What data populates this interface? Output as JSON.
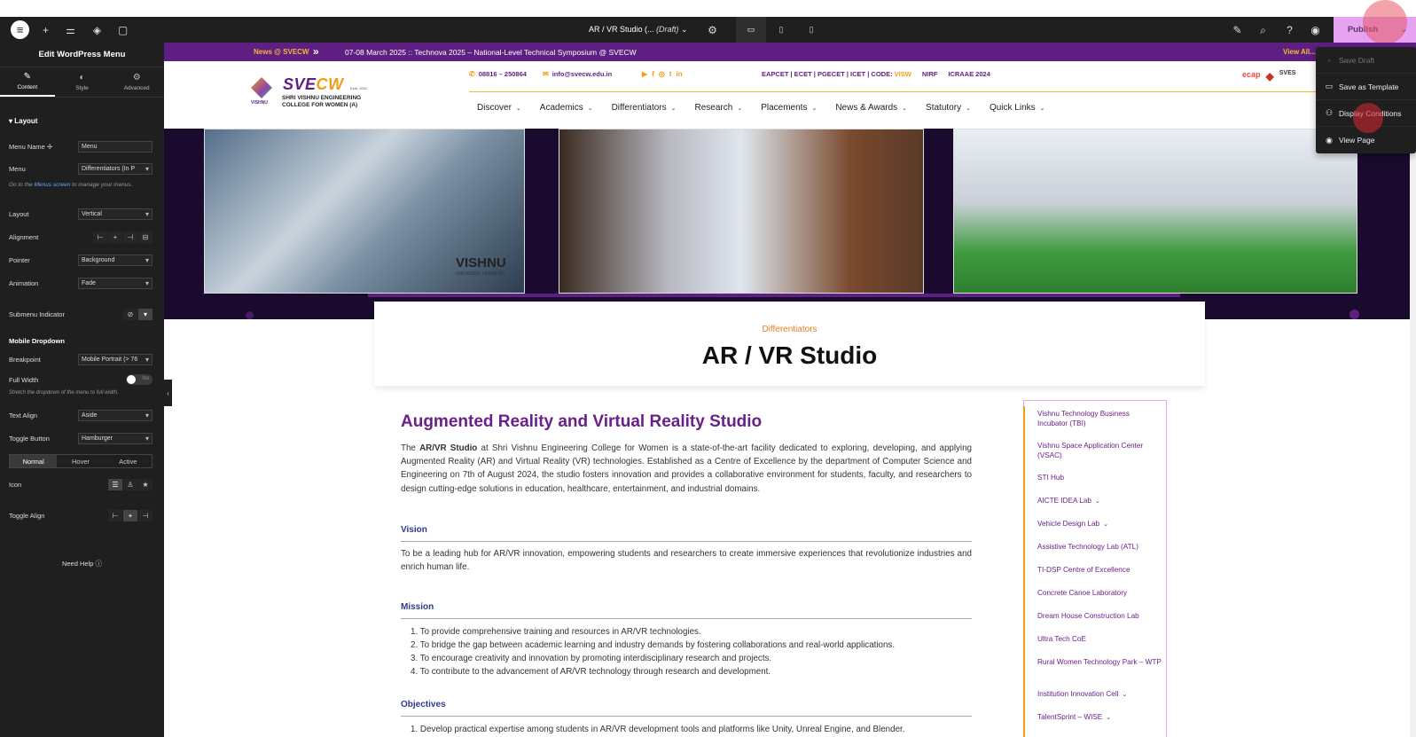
{
  "topbar": {
    "logo_icon": "elementor-logo-icon",
    "doc_title": "AR / VR Studio (... ",
    "doc_status": "(Draft)",
    "publish_label": "Publish"
  },
  "publish_menu": {
    "items": [
      {
        "label": "Save Draft",
        "icon": "save-draft-icon"
      },
      {
        "label": "Save as Template",
        "icon": "folder-icon"
      },
      {
        "label": "Display Conditions",
        "icon": "conditions-icon"
      },
      {
        "label": "View Page",
        "icon": "eye-icon"
      }
    ]
  },
  "panel": {
    "title": "Edit WordPress Menu",
    "tabs": [
      "Content",
      "Style",
      "Advanced"
    ],
    "section": "Layout",
    "menu_name_label": "Menu Name",
    "menu_name_value": "Menu",
    "menu_label": "Menu",
    "menu_value": "Differentiators (In P",
    "menus_hint_pre": "Go to the",
    "menus_hint_link": "Menus screen",
    "menus_hint_post": "to manage your menus.",
    "layout_label": "Layout",
    "layout_value": "Vertical",
    "alignment_label": "Alignment",
    "pointer_label": "Pointer",
    "pointer_value": "Background",
    "animation_label": "Animation",
    "animation_value": "Fade",
    "submenu_indicator_label": "Submenu Indicator",
    "mobile_dropdown_heading": "Mobile Dropdown",
    "breakpoint_label": "Breakpoint",
    "breakpoint_value": "Mobile Portrait (> 76",
    "full_width_label": "Full Width",
    "full_width_toggle": "No",
    "full_width_hint": "Stretch the dropdown of the menu to full width.",
    "text_align_label": "Text Align",
    "text_align_value": "Aside",
    "toggle_button_label": "Toggle Button",
    "toggle_button_value": "Hamburger",
    "state_tabs": [
      "Normal",
      "Hover",
      "Active"
    ],
    "icon_label": "Icon",
    "toggle_align_label": "Toggle Align",
    "need_help": "Need Help"
  },
  "site": {
    "news_label": "News @ SVECW",
    "news_text": "07-08 March 2025 :: Technova 2025 – National-Level Technical Symposium @ SVECW",
    "view_all": "View All...",
    "logo": {
      "wordmark_a": "SVE",
      "wordmark_b": "CW",
      "est": "Estd. 2001",
      "brand": "VISHNU",
      "line1": "SHRI VISHNU ENGINEERING",
      "line2": "COLLEGE FOR WOMEN (A)"
    },
    "phone": "08816 – 250864",
    "email": "info@svecw.edu.in",
    "quick_codes": [
      "EAPCET | ECET | PGECET | ICET | CODE:",
      "VISW",
      "NIRF",
      "ICRAAE 2024"
    ],
    "nav": [
      "Discover",
      "Academics",
      "Differentiators",
      "Research",
      "Placements",
      "News & Awards",
      "Statutory",
      "Quick Links"
    ],
    "header_logos": [
      "ecap",
      "SVES"
    ],
    "hero_brand": "VISHNU",
    "hero_brand_sub": "UNIVERSAL LEARNING"
  },
  "page": {
    "breadcrumb": "Differentiators",
    "title": "AR / VR Studio",
    "heading": "Augmented Reality and Virtual Reality Studio",
    "intro_pre": "The ",
    "intro_bold": "AR/VR Studio",
    "intro_post": " at Shri Vishnu Engineering College for Women is a state-of-the-art facility dedicated to exploring, developing, and applying Augmented Reality (AR) and Virtual Reality (VR) technologies. Established as a Centre of Excellence by the department of Computer Science and Engineering on 7th of August 2024, the studio fosters innovation and provides a collaborative environment for students, faculty, and researchers to design cutting-edge solutions in education, healthcare, entertainment, and industrial domains.",
    "vision_heading": "Vision",
    "vision_text": "To be a leading hub for AR/VR innovation, empowering students and researchers to create immersive experiences that revolutionize industries and enrich human life.",
    "mission_heading": "Mission",
    "mission_items": [
      "1. To provide comprehensive training and resources in AR/VR technologies.",
      "2. To bridge the gap between academic learning and industry demands by fostering collaborations and real-world applications.",
      "3. To encourage creativity and innovation by promoting interdisciplinary research and projects.",
      "4. To contribute to the advancement of AR/VR technology through research and development."
    ],
    "objectives_heading": "Objectives",
    "objectives_items": [
      "1. Develop practical expertise among students in AR/VR development tools and platforms like Unity, Unreal Engine, and Blender."
    ]
  },
  "sidebar": {
    "items": [
      {
        "label": "Vishnu Technology Business Incubator (TBI)",
        "chev": ""
      },
      {
        "label": "Vishnu Space Application Center (VSAC)",
        "chev": ""
      },
      {
        "label": "STI Hub",
        "chev": ""
      },
      {
        "label": "AICTE IDEA Lab",
        "chev": "⌄"
      },
      {
        "label": "Vehicle Design Lab",
        "chev": "⌄"
      },
      {
        "label": "Assistive Technology Lab (ATL)",
        "chev": ""
      },
      {
        "label": "TI-DSP Centre of Excellence",
        "chev": ""
      },
      {
        "label": "Concrete Canoe Laboratory",
        "chev": ""
      },
      {
        "label": "Dream House Construction Lab",
        "chev": ""
      },
      {
        "label": "Ultra Tech CoE",
        "chev": ""
      },
      {
        "label": "Rural Women Technology Park – WTP",
        "chev": ""
      },
      {
        "label": "Institution Innovation Cell",
        "chev": "⌄"
      },
      {
        "label": "TalentSprint – WISE",
        "chev": "⌄"
      }
    ]
  },
  "colors": {
    "brand_purple": "#5e1f82",
    "accent_orange": "#f39c12",
    "publish_bg": "#e7a3f2",
    "editor_dark": "#1f1f1f"
  }
}
